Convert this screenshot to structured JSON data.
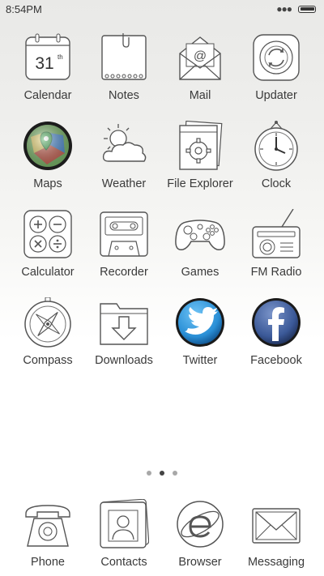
{
  "status_bar": {
    "time": "8:54PM",
    "overflow_icon": "ellipsis-icon",
    "battery_icon": "battery-icon"
  },
  "calendar_date": "31",
  "calendar_suffix": "th",
  "apps": [
    {
      "label": "Calendar",
      "icon": "calendar-icon"
    },
    {
      "label": "Notes",
      "icon": "notes-icon"
    },
    {
      "label": "Mail",
      "icon": "mail-icon"
    },
    {
      "label": "Updater",
      "icon": "updater-icon"
    },
    {
      "label": "Maps",
      "icon": "maps-icon"
    },
    {
      "label": "Weather",
      "icon": "weather-icon"
    },
    {
      "label": "File Explorer",
      "icon": "file-explorer-icon"
    },
    {
      "label": "Clock",
      "icon": "clock-icon"
    },
    {
      "label": "Calculator",
      "icon": "calculator-icon"
    },
    {
      "label": "Recorder",
      "icon": "recorder-icon"
    },
    {
      "label": "Games",
      "icon": "gamepad-icon"
    },
    {
      "label": "FM Radio",
      "icon": "radio-icon"
    },
    {
      "label": "Compass",
      "icon": "compass-icon"
    },
    {
      "label": "Downloads",
      "icon": "downloads-icon"
    },
    {
      "label": "Twitter",
      "icon": "twitter-icon"
    },
    {
      "label": "Facebook",
      "icon": "facebook-icon"
    }
  ],
  "page_indicator": {
    "count": 3,
    "active_index": 1
  },
  "dock": [
    {
      "label": "Phone",
      "icon": "phone-icon"
    },
    {
      "label": "Contacts",
      "icon": "contacts-icon"
    },
    {
      "label": "Browser",
      "icon": "browser-icon"
    },
    {
      "label": "Messaging",
      "icon": "messaging-icon"
    }
  ],
  "colors": {
    "line": "#555555",
    "twitter_blue": "#2a8fd6",
    "facebook_blue": "#3b5998"
  }
}
